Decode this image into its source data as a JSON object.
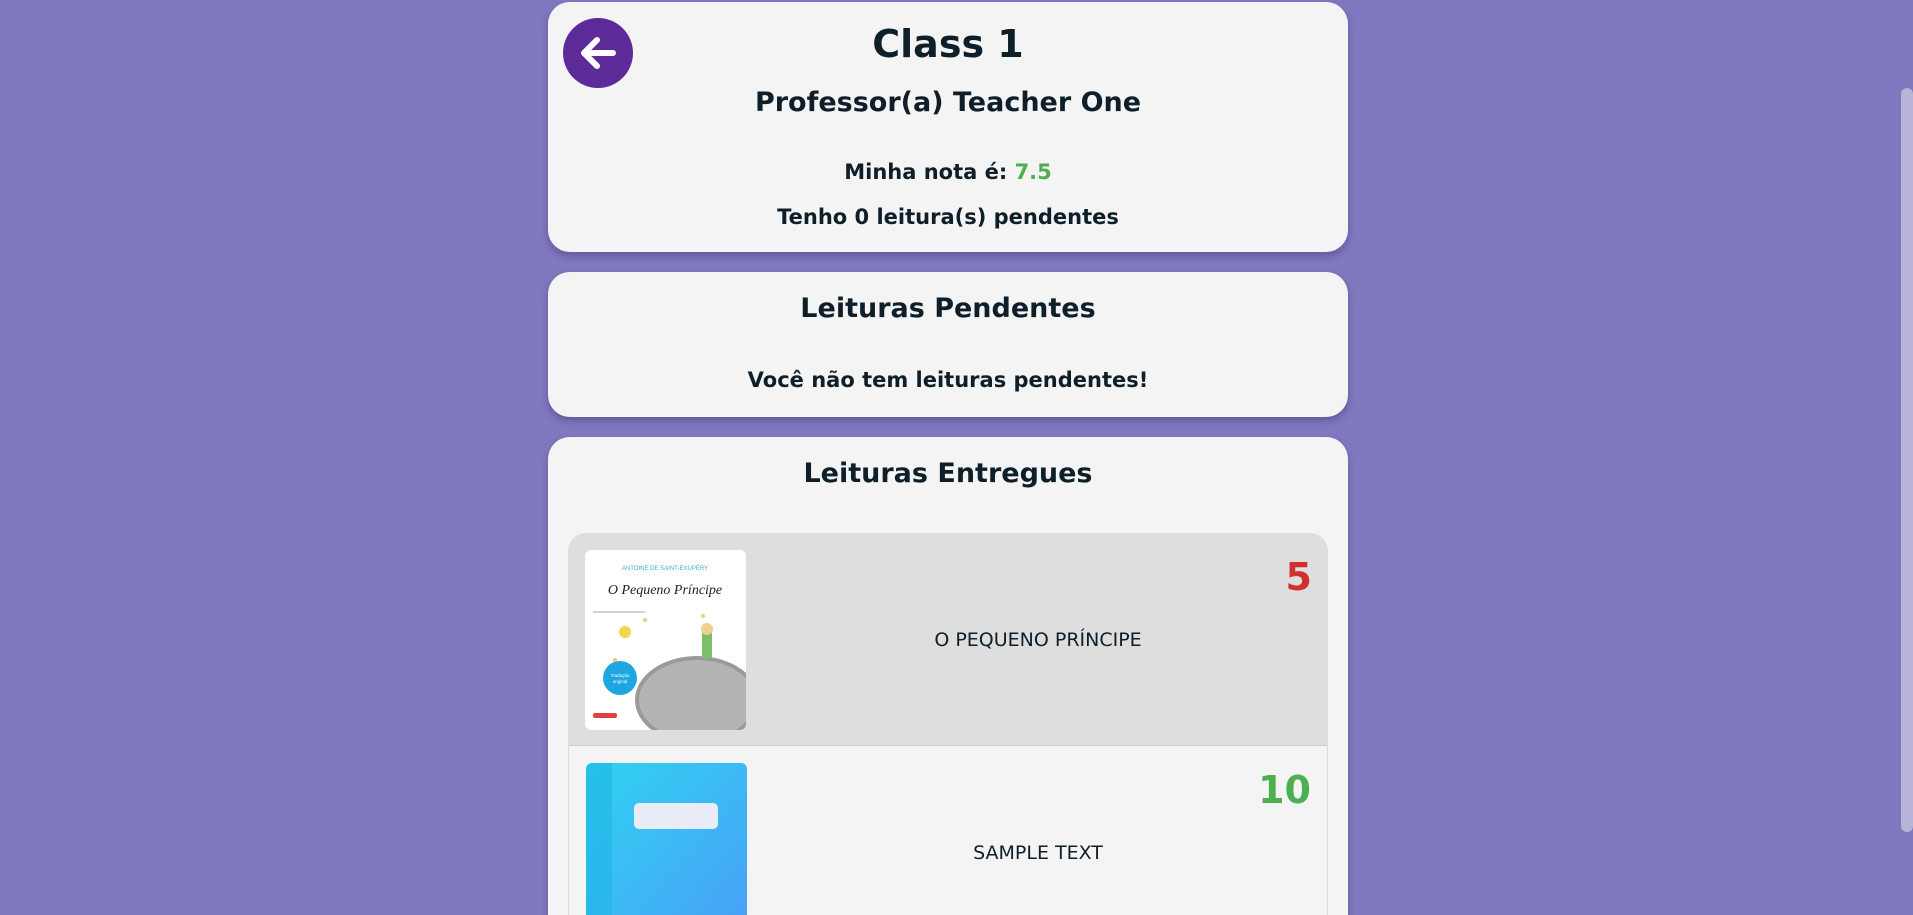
{
  "header": {
    "class_name": "Class 1",
    "professor": "Professor(a) Teacher One",
    "grade_label": "Minha nota é:",
    "grade_value": "7.5",
    "pending_text": "Tenho 0 leitura(s) pendentes"
  },
  "pending": {
    "title": "Leituras Pendentes",
    "empty_message": "Você não tem leituras pendentes!"
  },
  "delivered": {
    "title": "Leituras Entregues",
    "items": [
      {
        "title": "O PEQUENO PRÍNCIPE",
        "score": "5",
        "cover": {
          "author": "ANTOINE DE SAINT-EXUPÉRY",
          "title": "O Pequeno Príncipe"
        }
      },
      {
        "title": "SAMPLE TEXT",
        "score": "10",
        "cover": {}
      }
    ]
  },
  "colors": {
    "background": "#8079bf",
    "card": "#f4f4f4",
    "back_button": "#5d2a9a",
    "score_good": "#4caf50",
    "score_bad": "#d32f2f"
  }
}
